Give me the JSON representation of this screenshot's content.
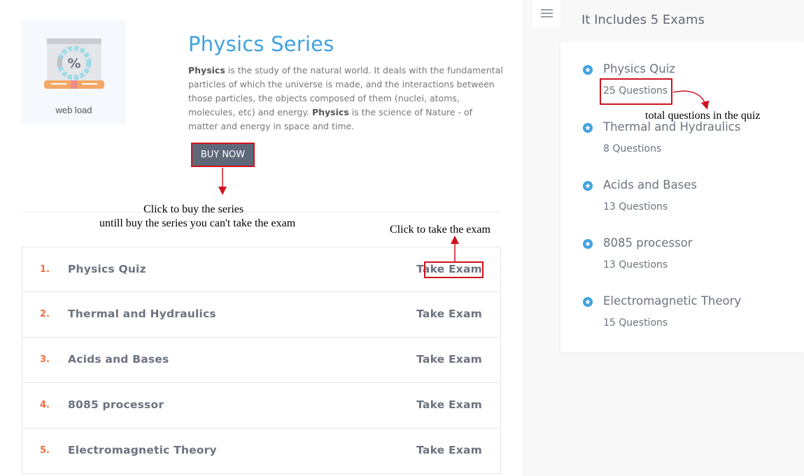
{
  "thumbnail": {
    "caption": "web load",
    "icon": "percent-gauge-illustration"
  },
  "series": {
    "title": "Physics Series",
    "desc": {
      "b1": "Physics",
      "t1": " is the study of the natural world. It deals with the fundamental particles of which the universe is made, and the interactions between those particles, the objects composed of them (nuclei, atoms, molecules, etc) and energy. ",
      "b2": "Physics",
      "t2": " is the science of Nature - of matter and energy in space and time."
    },
    "buy_label": "BUY NOW"
  },
  "annotations": {
    "buy_line1": "Click to buy the series",
    "buy_line2": "untill buy the series you can't take the exam",
    "take_exam": "Click to take the exam",
    "questions": "total questions in the quiz",
    "color": "#d0121f"
  },
  "exams": [
    {
      "num": "1.",
      "name": "Physics Quiz",
      "action": "Take Exam"
    },
    {
      "num": "2.",
      "name": "Thermal and Hydraulics",
      "action": "Take Exam"
    },
    {
      "num": "3.",
      "name": "Acids and Bases",
      "action": "Take Exam"
    },
    {
      "num": "4.",
      "name": "8085 processor",
      "action": "Take Exam"
    },
    {
      "num": "5.",
      "name": "Electromagnetic Theory",
      "action": "Take Exam"
    }
  ],
  "sidebar": {
    "menu_icon": "hamburger-menu-icon",
    "title": "It Includes 5 Exams",
    "items": [
      {
        "name": "Physics Quiz",
        "count": "25 Questions",
        "icon": "star-circle-icon"
      },
      {
        "name": "Thermal and Hydraulics",
        "count": "8 Questions",
        "icon": "star-circle-icon"
      },
      {
        "name": "Acids and Bases",
        "count": "13 Questions",
        "icon": "star-circle-icon"
      },
      {
        "name": "8085 processor",
        "count": "13 Questions",
        "icon": "star-circle-icon"
      },
      {
        "name": "Electromagnetic Theory",
        "count": "15 Questions",
        "icon": "star-circle-icon"
      }
    ]
  },
  "colors": {
    "title_blue": "#3fa2e0",
    "number_orange": "#f26d3d",
    "button_gray": "#5e6878",
    "icon_blue": "#3fa2e0"
  }
}
